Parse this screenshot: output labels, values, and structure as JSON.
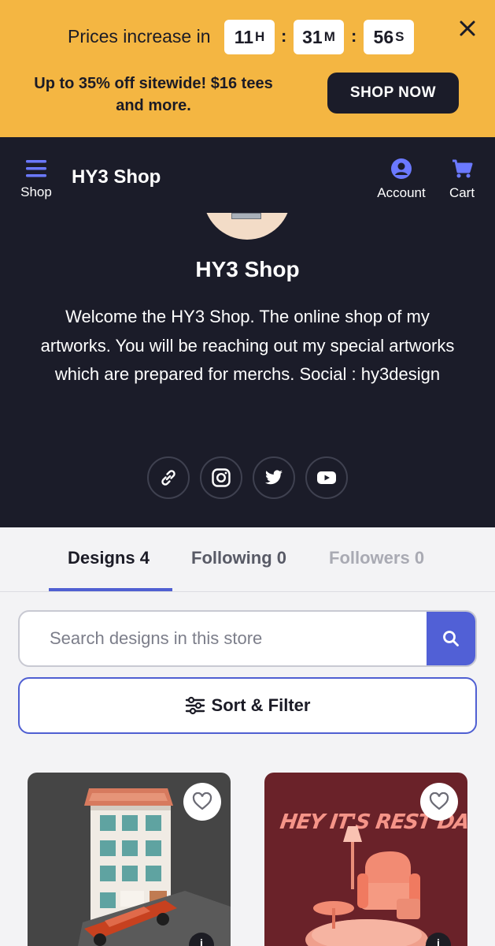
{
  "promo": {
    "prices_label": "Prices increase in",
    "timer": [
      {
        "value": "11",
        "unit": "H"
      },
      {
        "value": "31",
        "unit": "M"
      },
      {
        "value": "56",
        "unit": "S"
      }
    ],
    "offer": "Up to 35% off sitewide! $16 tees and more.",
    "shop_now_label": "SHOP NOW",
    "color": "#f4b642"
  },
  "nav": {
    "menu_label": "Shop",
    "brand": "HY3 Shop",
    "account_label": "Account",
    "cart_label": "Cart",
    "background": "#1b1c29"
  },
  "profile": {
    "title": "HY3 Shop",
    "description": "Welcome the HY3 Shop. The online shop of my artworks. You will be reaching out my special artworks which are prepared for merchs. Social : hy3design",
    "socials": [
      "link-icon",
      "instagram-icon",
      "twitter-icon",
      "youtube-icon"
    ]
  },
  "tabs": [
    {
      "label": "Designs",
      "count": "4",
      "active": true
    },
    {
      "label": "Following",
      "count": "0",
      "active": false
    },
    {
      "label": "Followers",
      "count": "0",
      "active": false
    }
  ],
  "search": {
    "placeholder": "Search designs in this store"
  },
  "sort_label": "Sort & Filter",
  "products": [
    {
      "art_text": ""
    },
    {
      "art_text": "HEY IT'S REST DAY"
    }
  ],
  "accent": "#5160d6"
}
